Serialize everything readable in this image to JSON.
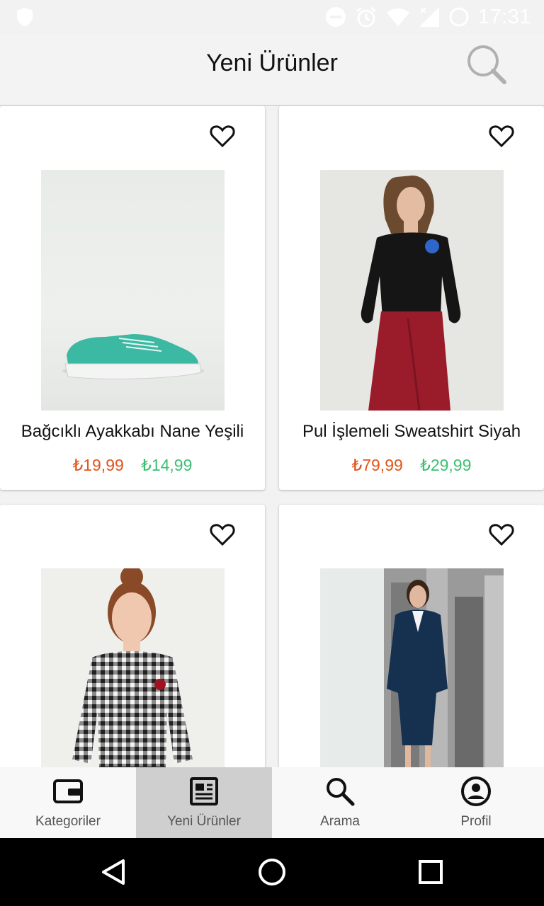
{
  "status_bar": {
    "time": "17:31",
    "icons": [
      "shield-icon",
      "dnd-icon",
      "alarm-icon",
      "wifi-icon",
      "signal-icon",
      "battery-icon"
    ]
  },
  "header": {
    "title": "Yeni Ürünler",
    "search_icon": "search-icon"
  },
  "products": [
    {
      "name": "Bağcıklı Ayakkabı Nane Yeşili",
      "old_price": "₺19,99",
      "new_price": "₺14,99",
      "image": "mint-green-sneaker"
    },
    {
      "name": "Pul İşlemeli Sweatshirt Siyah",
      "old_price": "₺79,99",
      "new_price": "₺29,99",
      "image": "black-sweatshirt-red-skirt"
    },
    {
      "name": "",
      "old_price": "",
      "new_price": "",
      "image": "gingham-top"
    },
    {
      "name": "",
      "old_price": "",
      "new_price": "",
      "image": "navy-trench-coat"
    }
  ],
  "bottom_nav": {
    "items": [
      {
        "label": "Kategoriler",
        "icon": "wallet-icon",
        "active": false
      },
      {
        "label": "Yeni Ürünler",
        "icon": "news-icon",
        "active": true
      },
      {
        "label": "Arama",
        "icon": "search-icon",
        "active": false
      },
      {
        "label": "Profil",
        "icon": "account-icon",
        "active": false
      }
    ]
  },
  "colors": {
    "old_price": "#e0541b",
    "new_price": "#3cbf73",
    "active_tab_bg": "#cfcfcf"
  }
}
